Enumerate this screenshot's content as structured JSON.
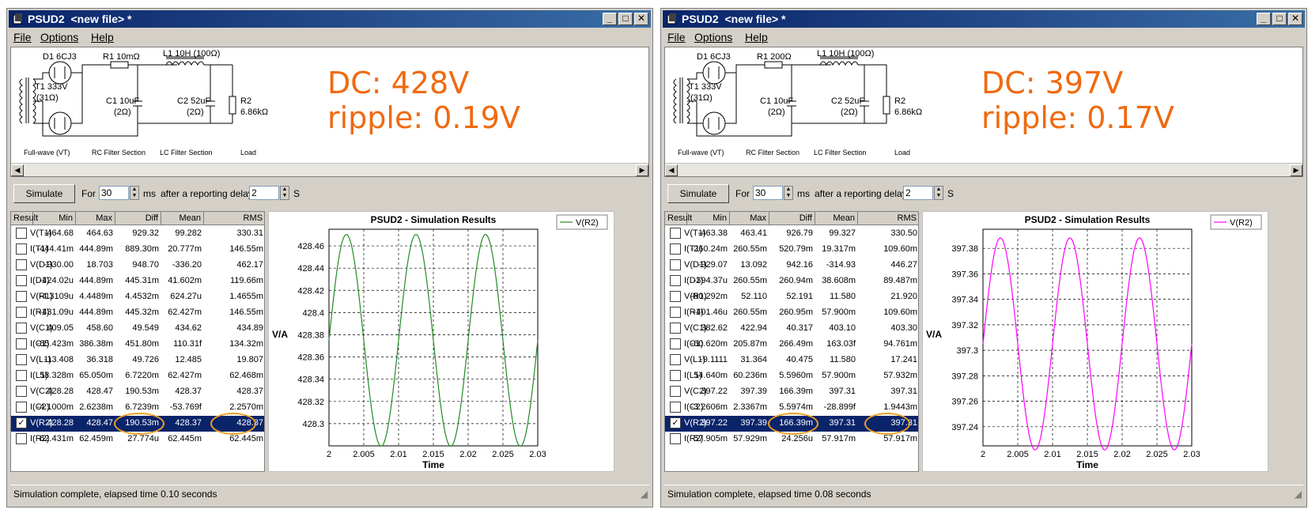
{
  "windows": [
    {
      "title": "PSUD2  <new file> *",
      "menu": [
        "File",
        "Options",
        "Help"
      ],
      "circuit": {
        "d1": "D1 6CJ3",
        "r1": "R1 10mΩ",
        "l1a": "L1 10H (100Ω)",
        "t1a": "T1 333V",
        "t1b": "(31Ω)",
        "c1a": "C1 10uF",
        "c1b": "(2Ω)",
        "c2a": "C2 52uF",
        "c2b": "(2Ω)",
        "r2a": "R2",
        "r2b": "6.86kΩ",
        "s1": "Full-wave (VT)",
        "s2": "RC Filter Section",
        "s3": "LC Filter Section",
        "s4": "Load"
      },
      "annot_dc": "DC: 428V",
      "annot_ripple": "ripple: 0.19V",
      "controls": {
        "sim": "Simulate",
        "for": "For",
        "ms_val": "30",
        "ms": "ms",
        "after": "after a reporting delay of",
        "delay_val": "2",
        "s": "S"
      },
      "headers": [
        "Result",
        "Min",
        "Max",
        "Diff",
        "Mean",
        "RMS"
      ],
      "rows": [
        {
          "name": "V(T1)",
          "min": "-464.68",
          "max": "464.63",
          "diff": "929.32",
          "mean": "99.282",
          "rms": "330.31",
          "checked": false
        },
        {
          "name": "I(T1)",
          "min": "-444.41m",
          "max": "444.89m",
          "diff": "889.30m",
          "mean": "20.777m",
          "rms": "146.55m",
          "checked": false
        },
        {
          "name": "V(D1)",
          "min": "-930.00",
          "max": "18.703",
          "diff": "948.70",
          "mean": "-336.20",
          "rms": "462.17",
          "checked": false
        },
        {
          "name": "I(D1)",
          "min": "-424.02u",
          "max": "444.89m",
          "diff": "445.31m",
          "mean": "41.602m",
          "rms": "119.66m",
          "checked": false
        },
        {
          "name": "V(R1)",
          "min": "-4.3109u",
          "max": "4.4489m",
          "diff": "4.4532m",
          "mean": "624.27u",
          "rms": "1.4655m",
          "checked": false
        },
        {
          "name": "I(R1)",
          "min": "-431.09u",
          "max": "444.89m",
          "diff": "445.32m",
          "mean": "62.427m",
          "rms": "146.55m",
          "checked": false
        },
        {
          "name": "V(C1)",
          "min": "409.05",
          "max": "458.60",
          "diff": "49.549",
          "mean": "434.62",
          "rms": "434.89",
          "checked": false
        },
        {
          "name": "I(C1)",
          "min": "-65.423m",
          "max": "386.38m",
          "diff": "451.80m",
          "mean": "110.31f",
          "rms": "134.32m",
          "checked": false
        },
        {
          "name": "V(L1)",
          "min": "-13.408",
          "max": "36.318",
          "diff": "49.726",
          "mean": "12.485",
          "rms": "19.807",
          "checked": false
        },
        {
          "name": "I(L1)",
          "min": "58.328m",
          "max": "65.050m",
          "diff": "6.7220m",
          "mean": "62.427m",
          "rms": "62.468m",
          "checked": false
        },
        {
          "name": "V(C2)",
          "min": "428.28",
          "max": "428.47",
          "diff": "190.53m",
          "mean": "428.37",
          "rms": "428.37",
          "checked": false
        },
        {
          "name": "I(C2)",
          "min": "-4.1000m",
          "max": "2.6238m",
          "diff": "6.7239m",
          "mean": "-53.769f",
          "rms": "2.2570m",
          "checked": false
        },
        {
          "name": "V(R2)",
          "min": "428.28",
          "max": "428.47",
          "diff": "190.53m",
          "mean": "428.37",
          "rms": "428.37",
          "checked": true
        },
        {
          "name": "I(R2)",
          "min": "62.431m",
          "max": "62.459m",
          "diff": "27.774u",
          "mean": "62.445m",
          "rms": "62.445m",
          "checked": false
        }
      ],
      "status": "Simulation complete, elapsed time 0.10 seconds",
      "chart_data": {
        "type": "line",
        "title": "PSUD2 - Simulation Results",
        "xlabel": "Time",
        "ylabel": "V/A",
        "xlim": [
          2,
          2.03
        ],
        "ylim": [
          428.28,
          428.475
        ],
        "xticks": [
          "2",
          "2.005",
          "2.01",
          "2.015",
          "2.02",
          "2.025",
          "2.03"
        ],
        "yticks": [
          "428.3",
          "428.32",
          "428.34",
          "428.36",
          "428.38",
          "428.4",
          "428.42",
          "428.44",
          "428.46"
        ],
        "legend": "top-right",
        "grid": true,
        "series": [
          {
            "name": "V(R2)",
            "color": "#228b22",
            "mean": 428.375,
            "amplitude": 0.0953,
            "period": 0.01,
            "phase_x": 2.0025,
            "x": [
              2,
              2.0025,
              2.005,
              2.0075,
              2.01,
              2.0125,
              2.015,
              2.0175,
              2.02,
              2.0225,
              2.025,
              2.0275,
              2.03
            ],
            "y": [
              428.375,
              428.47,
              428.375,
              428.28,
              428.375,
              428.47,
              428.375,
              428.28,
              428.375,
              428.47,
              428.375,
              428.28,
              428.375
            ]
          }
        ]
      }
    },
    {
      "title": "PSUD2  <new file> *",
      "menu": [
        "File",
        "Options",
        "Help"
      ],
      "circuit": {
        "d1": "D1 6CJ3",
        "r1": "R1 200Ω",
        "l1a": "L1 10H (100Ω)",
        "t1a": "T1 333V",
        "t1b": "(31Ω)",
        "c1a": "C1 10uF",
        "c1b": "(2Ω)",
        "c2a": "C2 52uF",
        "c2b": "(2Ω)",
        "r2a": "R2",
        "r2b": "6.86kΩ",
        "s1": "Full-wave (VT)",
        "s2": "RC Filter Section",
        "s3": "LC Filter Section",
        "s4": "Load"
      },
      "annot_dc": "DC: 397V",
      "annot_ripple": "ripple: 0.17V",
      "controls": {
        "sim": "Simulate",
        "for": "For",
        "ms_val": "30",
        "ms": "ms",
        "after": "after a reporting delay of",
        "delay_val": "2",
        "s": "S"
      },
      "headers": [
        "Result",
        "Min",
        "Max",
        "Diff",
        "Mean",
        "RMS"
      ],
      "rows": [
        {
          "name": "V(T1)",
          "min": "-463.38",
          "max": "463.41",
          "diff": "926.79",
          "mean": "99.327",
          "rms": "330.50",
          "checked": false
        },
        {
          "name": "I(T1)",
          "min": "-260.24m",
          "max": "260.55m",
          "diff": "520.79m",
          "mean": "19.317m",
          "rms": "109.60m",
          "checked": false
        },
        {
          "name": "V(D1)",
          "min": "-929.07",
          "max": "13.092",
          "diff": "942.16",
          "mean": "-314.93",
          "rms": "446.27",
          "checked": false
        },
        {
          "name": "I(D1)",
          "min": "-394.37u",
          "max": "260.55m",
          "diff": "260.94m",
          "mean": "38.608m",
          "rms": "89.487m",
          "checked": false
        },
        {
          "name": "V(R1)",
          "min": "-80.292m",
          "max": "52.110",
          "diff": "52.191",
          "mean": "11.580",
          "rms": "21.920",
          "checked": false
        },
        {
          "name": "I(R1)",
          "min": "-401.46u",
          "max": "260.55m",
          "diff": "260.95m",
          "mean": "57.900m",
          "rms": "109.60m",
          "checked": false
        },
        {
          "name": "V(C1)",
          "min": "382.62",
          "max": "422.94",
          "diff": "40.317",
          "mean": "403.10",
          "rms": "403.30",
          "checked": false
        },
        {
          "name": "I(C1)",
          "min": "-60.620m",
          "max": "205.87m",
          "diff": "266.49m",
          "mean": "163.03f",
          "rms": "94.761m",
          "checked": false
        },
        {
          "name": "V(L1)",
          "min": "-9.1111",
          "max": "31.364",
          "diff": "40.475",
          "mean": "11.580",
          "rms": "17.241",
          "checked": false
        },
        {
          "name": "I(L1)",
          "min": "54.640m",
          "max": "60.236m",
          "diff": "5.5960m",
          "mean": "57.900m",
          "rms": "57.932m",
          "checked": false
        },
        {
          "name": "V(C2)",
          "min": "397.22",
          "max": "397.39",
          "diff": "166.39m",
          "mean": "397.31",
          "rms": "397.31",
          "checked": false
        },
        {
          "name": "I(C2)",
          "min": "-3.2606m",
          "max": "2.3367m",
          "diff": "5.5974m",
          "mean": "-28.899f",
          "rms": "1.9443m",
          "checked": false
        },
        {
          "name": "V(R2)",
          "min": "397.22",
          "max": "397.39",
          "diff": "166.39m",
          "mean": "397.31",
          "rms": "397.31",
          "checked": true
        },
        {
          "name": "I(R2)",
          "min": "57.905m",
          "max": "57.929m",
          "diff": "24.256u",
          "mean": "57.917m",
          "rms": "57.917m",
          "checked": false
        }
      ],
      "status": "Simulation complete, elapsed time 0.08 seconds",
      "chart_data": {
        "type": "line",
        "title": "PSUD2 - Simulation Results",
        "xlabel": "Time",
        "ylabel": "V/A",
        "xlim": [
          2,
          2.03
        ],
        "ylim": [
          397.225,
          397.395
        ],
        "xticks": [
          "2",
          "2.005",
          "2.01",
          "2.015",
          "2.02",
          "2.025",
          "2.03"
        ],
        "yticks": [
          "397.24",
          "397.26",
          "397.28",
          "397.3",
          "397.32",
          "397.34",
          "397.36",
          "397.38"
        ],
        "legend": "top-right",
        "grid": true,
        "series": [
          {
            "name": "V(R2)",
            "color": "#ff00ff",
            "mean": 397.305,
            "amplitude": 0.0832,
            "period": 0.01,
            "phase_x": 2.0025,
            "x": [
              2,
              2.0025,
              2.005,
              2.0075,
              2.01,
              2.0125,
              2.015,
              2.0175,
              2.02,
              2.0225,
              2.025,
              2.0275,
              2.03
            ],
            "y": [
              397.305,
              397.39,
              397.305,
              397.22,
              397.305,
              397.39,
              397.305,
              397.22,
              397.305,
              397.39,
              397.305,
              397.22,
              397.305
            ]
          }
        ]
      }
    }
  ]
}
